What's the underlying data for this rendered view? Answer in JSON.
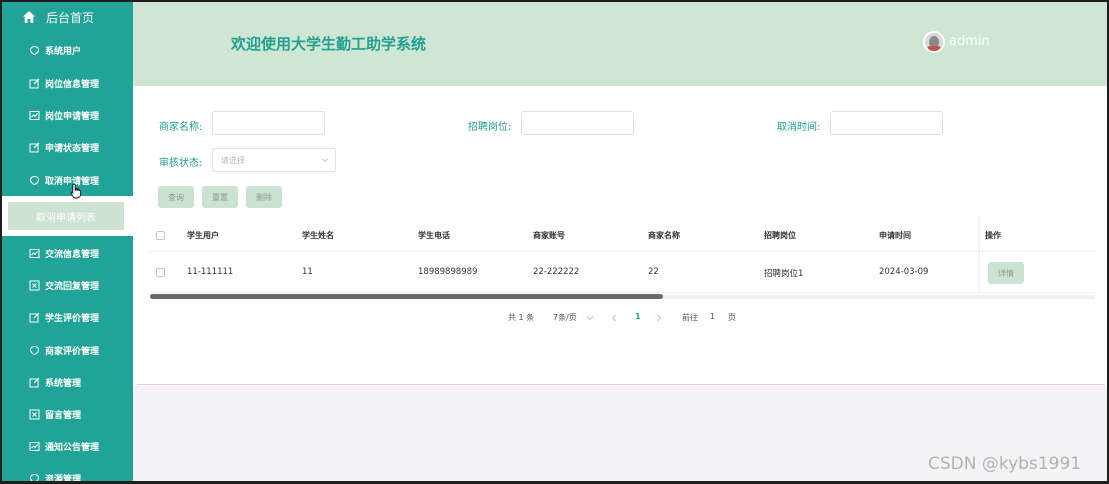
{
  "sidebar": {
    "home": {
      "label": "后台首页",
      "icon": "home-icon"
    },
    "items": [
      {
        "label": "系统用户",
        "icon": "bubble-icon"
      },
      {
        "label": "岗位信息管理",
        "icon": "edit-icon"
      },
      {
        "label": "岗位申请管理",
        "icon": "chart-icon"
      },
      {
        "label": "申请状态管理",
        "icon": "edit-icon"
      },
      {
        "label": "取消申请管理",
        "icon": "bubble-icon"
      },
      {
        "label": "交流信息管理",
        "icon": "chart-icon"
      },
      {
        "label": "交流回复管理",
        "icon": "close-box-icon"
      },
      {
        "label": "学生评价管理",
        "icon": "edit-icon"
      },
      {
        "label": "商家评价管理",
        "icon": "bubble-icon"
      },
      {
        "label": "系统管理",
        "icon": "edit-icon"
      },
      {
        "label": "留言管理",
        "icon": "close-box-icon"
      },
      {
        "label": "通知公告管理",
        "icon": "chart-icon"
      },
      {
        "label": "资源管理",
        "icon": "bubble-icon"
      }
    ],
    "active_sub": "取消申请列表",
    "accent": "#21a497"
  },
  "header": {
    "title": "欢迎使用大学生勤工助学系统",
    "user": "admin",
    "background": "#cfe6d4"
  },
  "search": {
    "merchant_name_label": "商家名称:",
    "position_label": "招聘岗位:",
    "cancel_time_label": "取消时间:",
    "review_status_label": "审核状态:",
    "review_status_placeholder": "请选择",
    "query_button": "查询",
    "reset_button": "重置",
    "delete_button": "删除"
  },
  "table": {
    "columns": [
      "学生用户",
      "学生姓名",
      "学生电话",
      "商家账号",
      "商家名称",
      "招聘岗位",
      "申请时间",
      "操作"
    ],
    "rows": [
      [
        "11-111111",
        "11",
        "18989898989",
        "22-222222",
        "22",
        "招聘岗位1",
        "2024-03-09"
      ]
    ],
    "detail_button": "详情",
    "scroll_fraction": 0.54
  },
  "pagination": {
    "total": "共 1 条",
    "page_size": "7条/页",
    "current_page": "1",
    "goto_label": "前往",
    "goto_value": "1",
    "page_suffix": "页"
  },
  "watermark": "CSDN @kybs1991"
}
